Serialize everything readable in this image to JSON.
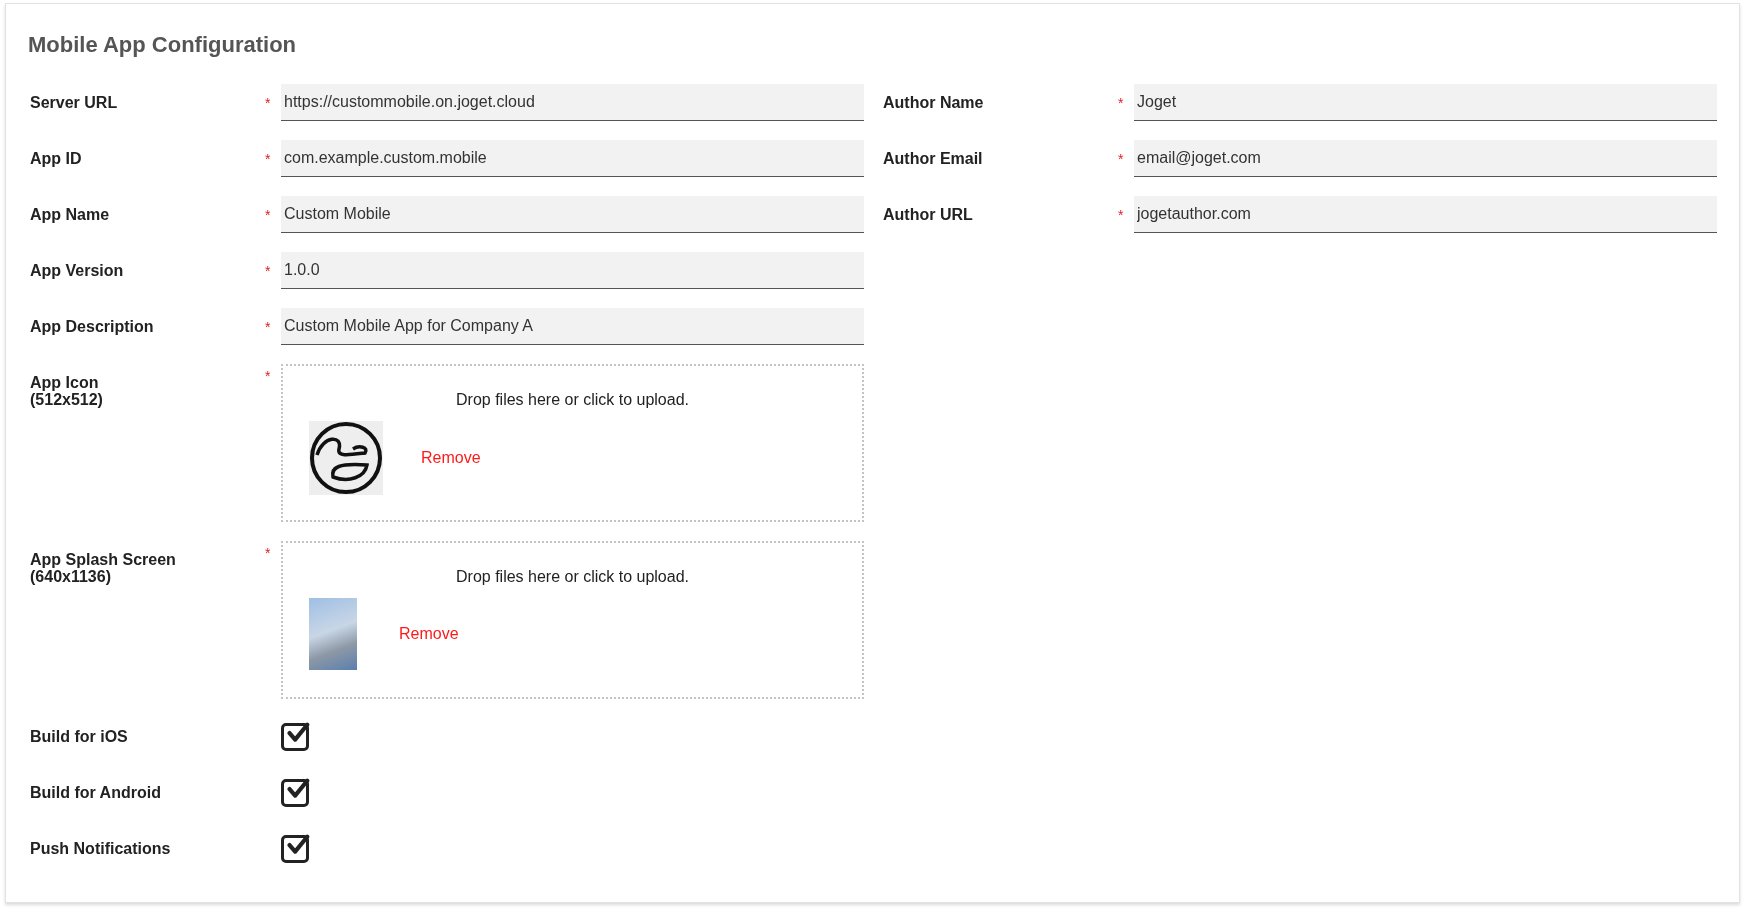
{
  "title": "Mobile App Configuration",
  "left_fields": [
    {
      "kind": "text",
      "label": "Server URL",
      "required_mark": "*",
      "value": "https://custommobile.on.joget.cloud"
    },
    {
      "kind": "text",
      "label": "App ID",
      "required_mark": "*",
      "value": "com.example.custom.mobile"
    },
    {
      "kind": "text",
      "label": "App Name",
      "required_mark": "*",
      "value": "Custom Mobile"
    },
    {
      "kind": "text",
      "label": "App Version",
      "required_mark": "*",
      "value": "1.0.0"
    },
    {
      "kind": "text",
      "label": "App Description",
      "required_mark": "*",
      "value": "Custom Mobile App for Company A"
    },
    {
      "kind": "upload",
      "label": "App Icon\n(512x512)",
      "required_mark": "*",
      "dropzone_text": "Drop files here or click to upload.",
      "preview": {
        "kind": "logo"
      },
      "remove_link": "Remove"
    },
    {
      "kind": "upload",
      "label": "App Splash Screen\n(640x1136)",
      "required_mark": "*",
      "dropzone_text": "Drop files here or click to upload.",
      "preview": {
        "kind": "photo"
      },
      "remove_link": "Remove"
    },
    {
      "kind": "checkbox",
      "label": "Build for iOS",
      "checked": true
    },
    {
      "kind": "checkbox",
      "label": "Build for Android",
      "checked": true
    },
    {
      "kind": "checkbox",
      "label": "Push Notifications",
      "checked": true
    }
  ],
  "right_fields": [
    {
      "kind": "text",
      "label": "Author Name",
      "required_mark": "*",
      "value": "Joget"
    },
    {
      "kind": "text",
      "label": "Author Email",
      "required_mark": "*",
      "value": "email@joget.com"
    },
    {
      "kind": "text",
      "label": "Author URL",
      "required_mark": "*",
      "value": "jogetauthor.com"
    }
  ]
}
